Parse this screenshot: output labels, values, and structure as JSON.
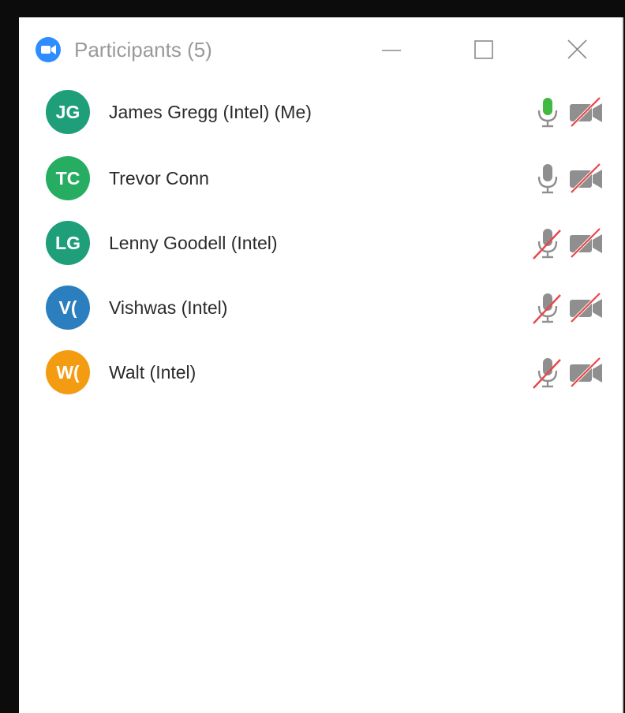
{
  "window": {
    "title": "Participants (5)",
    "logo_icon": "zoom-logo-icon",
    "controls": [
      "minimize-icon",
      "maximize-icon",
      "close-icon"
    ]
  },
  "participants": [
    {
      "initials": "JG",
      "name": "James Gregg (Intel) (Me)",
      "avatar_color": "#1f9e7a",
      "mic": "on-speaking",
      "video": "off"
    },
    {
      "initials": "TC",
      "name": "Trevor Conn",
      "avatar_color": "#27ad62",
      "mic": "on",
      "video": "off"
    },
    {
      "initials": "LG",
      "name": "Lenny Goodell (Intel)",
      "avatar_color": "#1f9e7a",
      "mic": "muted",
      "video": "off"
    },
    {
      "initials": "V(",
      "name": "Vishwas (Intel)",
      "avatar_color": "#2b7fbf",
      "mic": "muted",
      "video": "off"
    },
    {
      "initials": "W(",
      "name": "Walt (Intel)",
      "avatar_color": "#f39c12",
      "mic": "muted",
      "video": "off"
    }
  ],
  "colors": {
    "mic_active": "#3fb93f",
    "icon_gray": "#8f8f8f",
    "slash_red": "#e84848",
    "title_gray": "#9a9a9a"
  }
}
